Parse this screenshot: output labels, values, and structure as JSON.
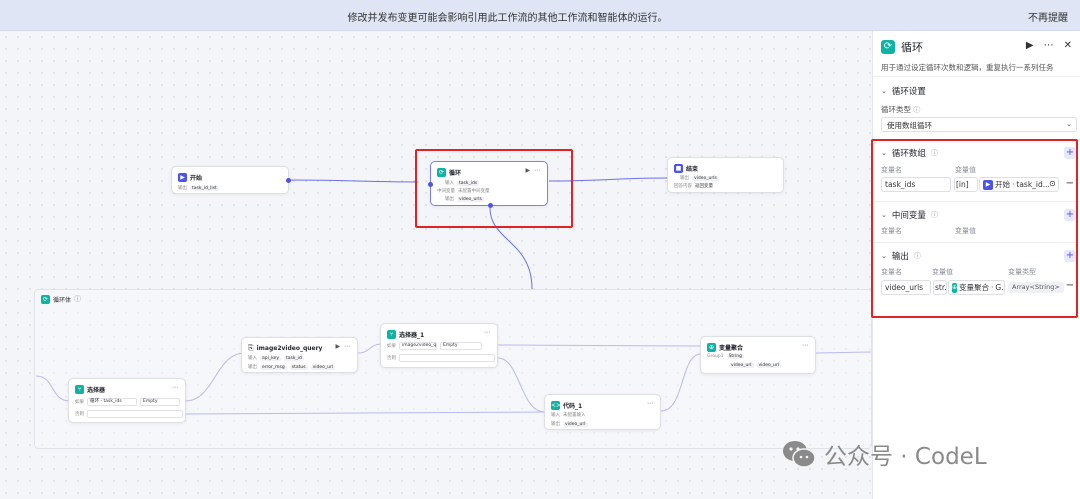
{
  "banner": {
    "message": "修改并发布变更可能会影响引用此工作流的其他工作流和智能体的运行。",
    "dismiss": "不再提醒"
  },
  "nodes": {
    "start": {
      "title": "开始",
      "out_label": "输出",
      "var": "task_id_list"
    },
    "loop": {
      "title": "循环",
      "in_label": "输入",
      "in_var": "task_ids",
      "mid_label": "中间变量",
      "mid_value": "未配置中间变量",
      "out_label": "输出",
      "out_var": "video_urls"
    },
    "end": {
      "title": "结束",
      "out_label": "输出",
      "out_var": "video_urls",
      "ans_label": "回答内容",
      "ans_value": "返回变量"
    },
    "loop_body": {
      "title": "循环体"
    },
    "selector": {
      "title": "选择器",
      "if_label": "如果",
      "var": "循环 - task_ids",
      "op": "Empty",
      "else_label": "否则"
    },
    "i2v": {
      "title": "image2video_query",
      "in_label": "输入",
      "in_vars": [
        "api_key",
        "task_id"
      ],
      "out_label": "输出",
      "out_vars": [
        "error_msg",
        "status",
        "video_url"
      ]
    },
    "selector1": {
      "title": "选择器_1",
      "if_label": "如果",
      "var": "image2video_qu...",
      "op": "Empty",
      "else_label": "否则"
    },
    "code1": {
      "title": "代码_1",
      "in_label": "输入",
      "in_value": "未配置输入",
      "out_label": "输出",
      "out_var": "video_url"
    },
    "agg": {
      "title": "变量聚合",
      "group_label": "Group1",
      "type": "String",
      "vars": [
        "video_url",
        "video_url"
      ]
    }
  },
  "panel": {
    "title": "循环",
    "description": "用于通过设定循环次数和逻辑，重复执行一系列任务",
    "settings": {
      "title": "循环设置",
      "type_label": "循环类型",
      "type_value": "使用数组循环"
    },
    "array": {
      "title": "循环数组",
      "col_name": "变量名",
      "col_value": "变量值",
      "name": "task_ids",
      "type_short": "[in]",
      "ref_node": "开始",
      "ref_var": "task_id..."
    },
    "middle": {
      "title": "中间变量",
      "col_name": "变量名",
      "col_value": "变量值"
    },
    "output": {
      "title": "输出",
      "col_name": "变量名",
      "col_value": "变量值",
      "col_type": "变量类型",
      "name": "video_urls",
      "type_short": "str.",
      "ref_node": "变量聚合",
      "ref_var": "G...",
      "type": "Array<String>"
    }
  },
  "watermark": {
    "text": "公众号 · CodeL"
  },
  "colors": {
    "accent": "#4d53e8",
    "loop": "#10b3a3",
    "red": "#e02424"
  }
}
